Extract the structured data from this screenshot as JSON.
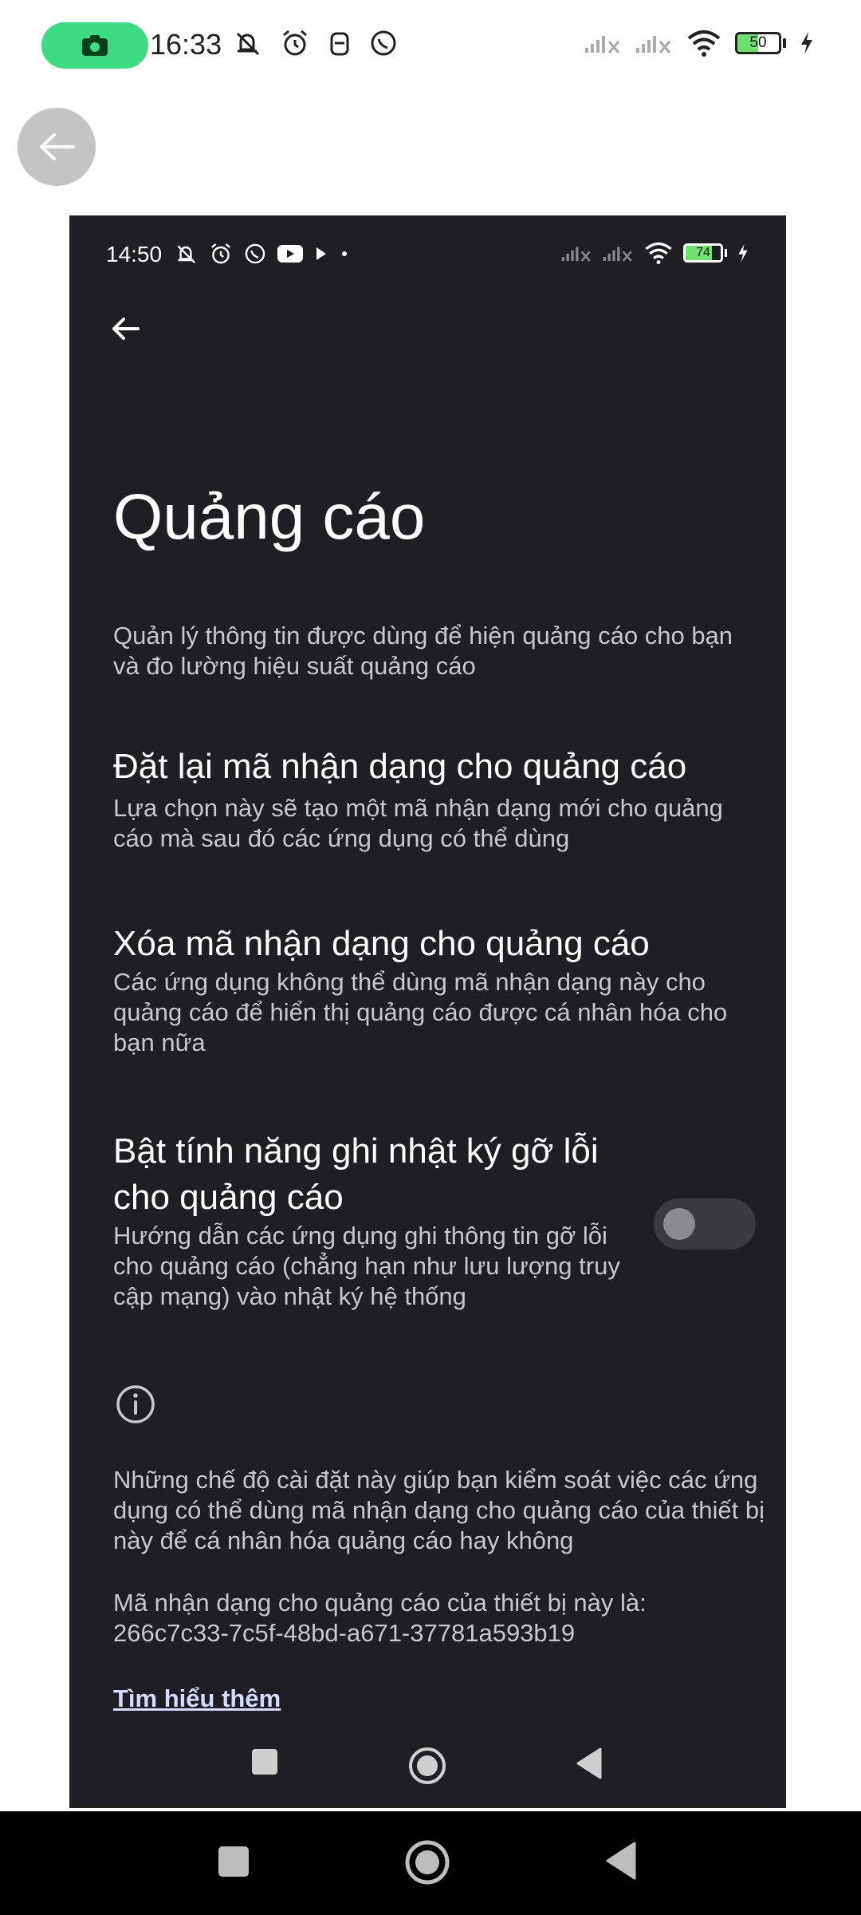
{
  "outer_status": {
    "time": "16:33",
    "battery_level": 50,
    "battery_label": "50",
    "recording_indicator": "camera-icon",
    "left_icons": [
      "bell-off-icon",
      "alarm-icon",
      "cup-icon",
      "whatsapp-icon"
    ],
    "right_icons": [
      "signal-x-icon",
      "signal-x-icon",
      "wifi-icon",
      "battery-icon",
      "charging-icon"
    ]
  },
  "floating_back": {
    "icon": "arrow-left-icon"
  },
  "inner_status": {
    "time": "14:50",
    "battery_level": 74,
    "battery_label": "74",
    "left_icons": [
      "bell-off-icon",
      "alarm-icon",
      "whatsapp-icon",
      "youtube-icon",
      "play-icon",
      "dot-icon"
    ],
    "right_icons": [
      "signal-x-icon",
      "signal-x-icon",
      "wifi-icon",
      "battery-icon",
      "charging-icon"
    ]
  },
  "page": {
    "title": "Quảng cáo",
    "subtitle": "Quản lý thông tin được dùng để hiện quảng cáo cho bạn và đo lường hiệu suất quảng cáo",
    "items": [
      {
        "title": "Đặt lại mã nhận dạng cho quảng cáo",
        "desc": "Lựa chọn này sẽ tạo một mã nhận dạng mới cho quảng cáo mà sau đó các ứng dụng có thể dùng"
      },
      {
        "title": "Xóa mã nhận dạng cho quảng cáo",
        "desc": "Các ứng dụng không thể dùng mã nhận dạng này cho quảng cáo để hiển thị quảng cáo được cá nhân hóa cho bạn nữa"
      },
      {
        "title": "Bật tính năng ghi nhật ký gỡ lỗi cho quảng cáo",
        "desc": "Hướng dẫn các ứng dụng ghi thông tin gỡ lỗi cho quảng cáo (chẳng hạn như lưu lượng truy cập mạng) vào nhật ký hệ thống",
        "toggle_on": false
      }
    ],
    "info_text": "Những chế độ cài đặt này giúp bạn kiểm soát việc các ứng dụng có thể dùng mã nhận dạng cho quảng cáo của thiết bị này để cá nhân hóa quảng cáo hay không",
    "device_id_label": "Mã nhận dạng cho quảng cáo của thiết bị này là:",
    "device_id": "266c7c33-7c5f-48bd-a671-37781a593b19",
    "learn_more": "Tìm hiểu thêm"
  },
  "nav": {
    "recents": "square-icon",
    "home": "circle-icon",
    "back": "triangle-back-icon"
  },
  "colors": {
    "inner_background": "#1f1f23",
    "outer_nav_background": "#000000",
    "recording_pill": "#3ddc84",
    "battery_fill": "#6ee26e"
  }
}
